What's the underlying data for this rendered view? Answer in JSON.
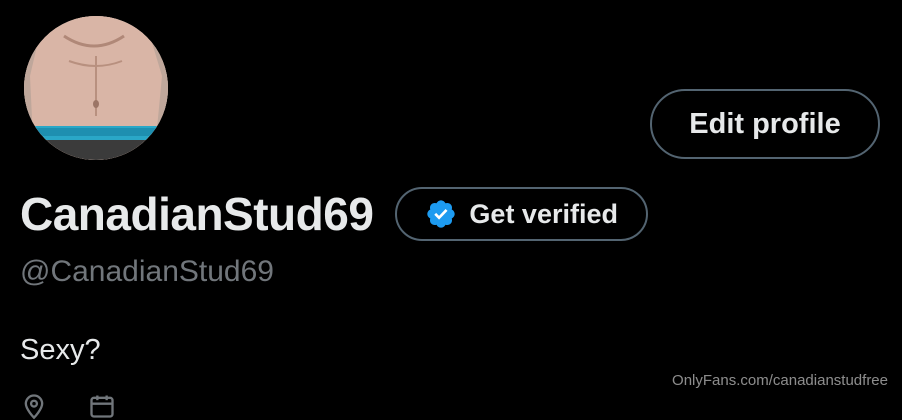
{
  "profile": {
    "display_name": "CanadianStud69",
    "handle": "@CanadianStud69",
    "bio": "Sexy?",
    "avatar_icon": "profile-photo",
    "edit_label": "Edit profile",
    "get_verified_label": "Get verified",
    "verified_badge_icon": "verified-badge-icon",
    "meta": [
      {
        "icon": "location-icon",
        "text": ""
      },
      {
        "icon": "calendar-icon",
        "text": ""
      }
    ]
  },
  "watermark": "OnlyFans.com/canadianstudfree",
  "colors": {
    "background": "#000000",
    "primary_text": "#e7e9ea",
    "secondary_text": "#71767b",
    "button_border": "#536471",
    "verified_blue": "#1d9bf0"
  }
}
